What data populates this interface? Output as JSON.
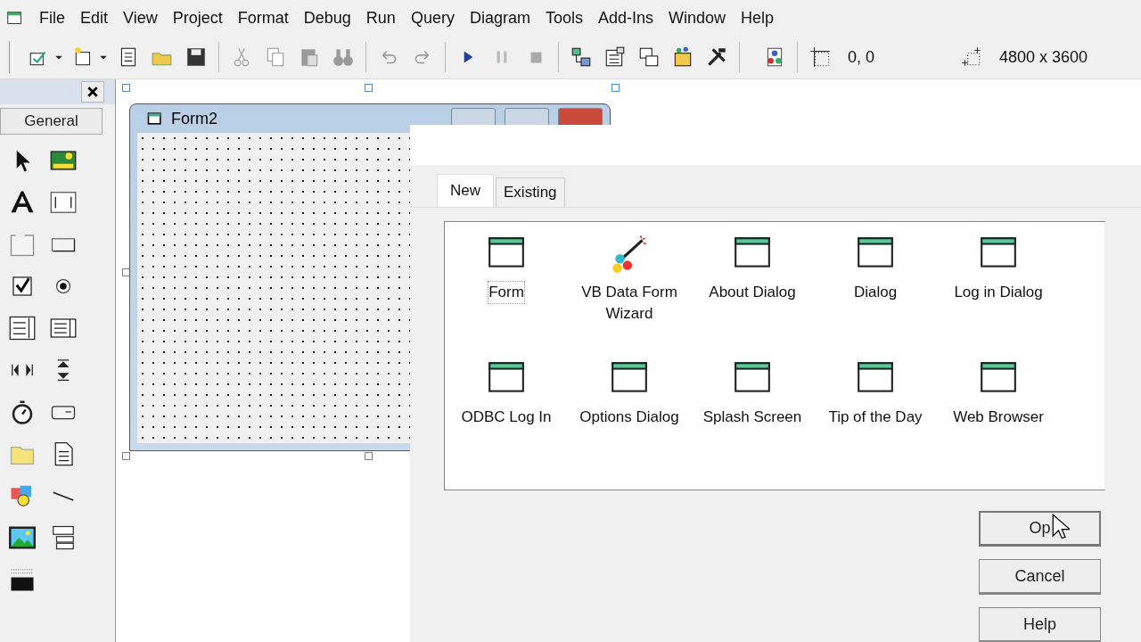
{
  "menu_bar": {
    "items": [
      "File",
      "Edit",
      "View",
      "Project",
      "Format",
      "Debug",
      "Run",
      "Query",
      "Diagram",
      "Tools",
      "Add-Ins",
      "Window",
      "Help"
    ]
  },
  "toolbar": {
    "position": "0, 0",
    "size": "4800 x 3600"
  },
  "toolbox": {
    "tab": "General"
  },
  "form_window": {
    "title": "Form2"
  },
  "dialog": {
    "tabs": [
      {
        "label": "New",
        "selected": true
      },
      {
        "label": "Existing",
        "selected": false
      }
    ],
    "templates": [
      {
        "label": "Form",
        "selected": true,
        "kind": "wizard-none"
      },
      {
        "label": "VB Data Form Wizard",
        "selected": false,
        "kind": "wand"
      },
      {
        "label": "About Dialog",
        "selected": false,
        "kind": "form"
      },
      {
        "label": "Dialog",
        "selected": false,
        "kind": "form"
      },
      {
        "label": "Log in Dialog",
        "selected": false,
        "kind": "form"
      },
      {
        "label": "ODBC Log In",
        "selected": false,
        "kind": "form"
      },
      {
        "label": "Options Dialog",
        "selected": false,
        "kind": "form"
      },
      {
        "label": "Splash Screen",
        "selected": false,
        "kind": "form"
      },
      {
        "label": "Tip of the Day",
        "selected": false,
        "kind": "form"
      },
      {
        "label": "Web Browser",
        "selected": false,
        "kind": "form"
      }
    ],
    "buttons": [
      "Op",
      "Cancel",
      "Help"
    ]
  }
}
